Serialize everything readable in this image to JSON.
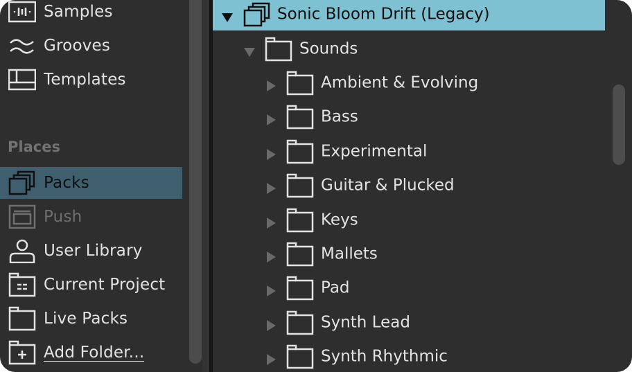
{
  "sidebar": {
    "categories": [
      {
        "label": "Samples",
        "icon": "waveform-icon"
      },
      {
        "label": "Grooves",
        "icon": "groove-wave-icon"
      },
      {
        "label": "Templates",
        "icon": "template-grid-icon"
      }
    ],
    "places_header": "Places",
    "places": [
      {
        "label": "Packs",
        "icon": "packs-stack-icon",
        "state": "selected"
      },
      {
        "label": "Push",
        "icon": "push-device-icon",
        "state": "disabled"
      },
      {
        "label": "User Library",
        "icon": "user-icon",
        "state": "normal"
      },
      {
        "label": "Current Project",
        "icon": "project-folder-icon",
        "state": "normal"
      },
      {
        "label": "Live Packs",
        "icon": "folder-icon",
        "state": "normal"
      },
      {
        "label": "Add Folder...",
        "icon": "folder-add-icon",
        "state": "link"
      }
    ]
  },
  "tree": {
    "root": {
      "label": "Sonic Bloom Drift (Legacy)",
      "expanded": true,
      "icon": "packs-stack-icon"
    },
    "child": {
      "label": "Sounds",
      "expanded": true,
      "icon": "folder-icon"
    },
    "items": [
      {
        "label": "Ambient & Evolving",
        "expanded": false
      },
      {
        "label": "Bass",
        "expanded": false
      },
      {
        "label": "Experimental",
        "expanded": false
      },
      {
        "label": "Guitar & Plucked",
        "expanded": false
      },
      {
        "label": "Keys",
        "expanded": false
      },
      {
        "label": "Mallets",
        "expanded": false
      },
      {
        "label": "Pad",
        "expanded": false
      },
      {
        "label": "Synth Lead",
        "expanded": false
      },
      {
        "label": "Synth Rhythmic",
        "expanded": false
      }
    ]
  },
  "colors": {
    "background": "#2e2e2e",
    "sidebar_selected": "#3f5f6e",
    "tree_selected": "#7ec1d2",
    "text": "#e3e3e3",
    "muted_text": "#727272"
  }
}
